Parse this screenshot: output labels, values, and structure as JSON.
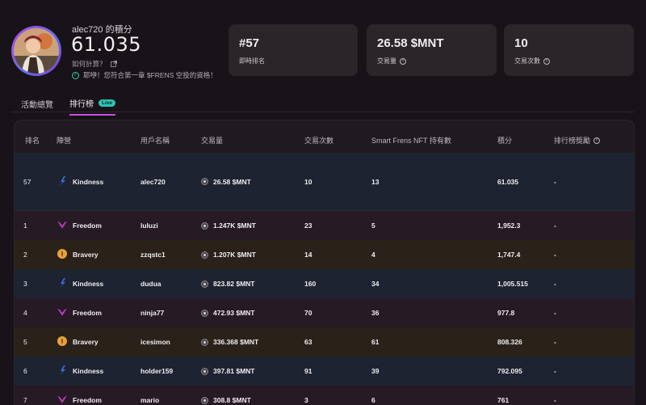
{
  "profile": {
    "username_title": "alec720 的積分",
    "score": "61.035",
    "howto_label": "如何計算？",
    "eligible_text": "耶咿！您符合第一章 $FRENS 空投的資格！"
  },
  "cards": [
    {
      "value": "#57",
      "label": "即時排名",
      "has_info": false
    },
    {
      "value": "26.58 $MNT",
      "label": "交易量",
      "has_info": true
    },
    {
      "value": "10",
      "label": "交易次數",
      "has_info": true
    }
  ],
  "tabs": [
    {
      "label": "活動總覽",
      "active": false
    },
    {
      "label": "排行榜",
      "active": true,
      "badge": "Live"
    }
  ],
  "table": {
    "headers": {
      "rank": "排名",
      "faction": "陣營",
      "user": "用戶名稱",
      "volume": "交易量",
      "trades": "交易次數",
      "nft": "Smart Frens NFT 持有數",
      "points": "積分",
      "reward": "排行榜獎勵"
    },
    "rows": [
      {
        "rank": "57",
        "faction": "Kindness",
        "user": "alec720",
        "volume": "26.58 $MNT",
        "trades": "10",
        "nft": "13",
        "points": "61.035",
        "reward": "-"
      },
      {
        "rank": "1",
        "faction": "Freedom",
        "user": "luluzi",
        "volume": "1.247K $MNT",
        "trades": "23",
        "nft": "5",
        "points": "1,952.3",
        "reward": "-"
      },
      {
        "rank": "2",
        "faction": "Bravery",
        "user": "zzqstc1",
        "volume": "1.207K $MNT",
        "trades": "14",
        "nft": "4",
        "points": "1,747.4",
        "reward": "-"
      },
      {
        "rank": "3",
        "faction": "Kindness",
        "user": "dudua",
        "volume": "823.82 $MNT",
        "trades": "160",
        "nft": "34",
        "points": "1,005.515",
        "reward": "-"
      },
      {
        "rank": "4",
        "faction": "Freedom",
        "user": "ninja77",
        "volume": "472.93 $MNT",
        "trades": "70",
        "nft": "36",
        "points": "977.8",
        "reward": "-"
      },
      {
        "rank": "5",
        "faction": "Bravery",
        "user": "icesimon",
        "volume": "336.368 $MNT",
        "trades": "63",
        "nft": "61",
        "points": "808.326",
        "reward": "-"
      },
      {
        "rank": "6",
        "faction": "Kindness",
        "user": "holder159",
        "volume": "397.81 $MNT",
        "trades": "91",
        "nft": "39",
        "points": "792.095",
        "reward": "-"
      },
      {
        "rank": "7",
        "faction": "Freedom",
        "user": "mario",
        "volume": "308.8 $MNT",
        "trades": "3",
        "nft": "6",
        "points": "761",
        "reward": "-"
      }
    ]
  },
  "colors": {
    "kindness_row": "#1d2330",
    "freedom_row": "#261a25",
    "bravery_row": "#2a2119",
    "kindness_icon": "#3a6fe0",
    "freedom_icon": "#c63fc9",
    "bravery_icon": "#e8a13a",
    "accent": "#c94fe3",
    "live": "#2ec4b6"
  }
}
